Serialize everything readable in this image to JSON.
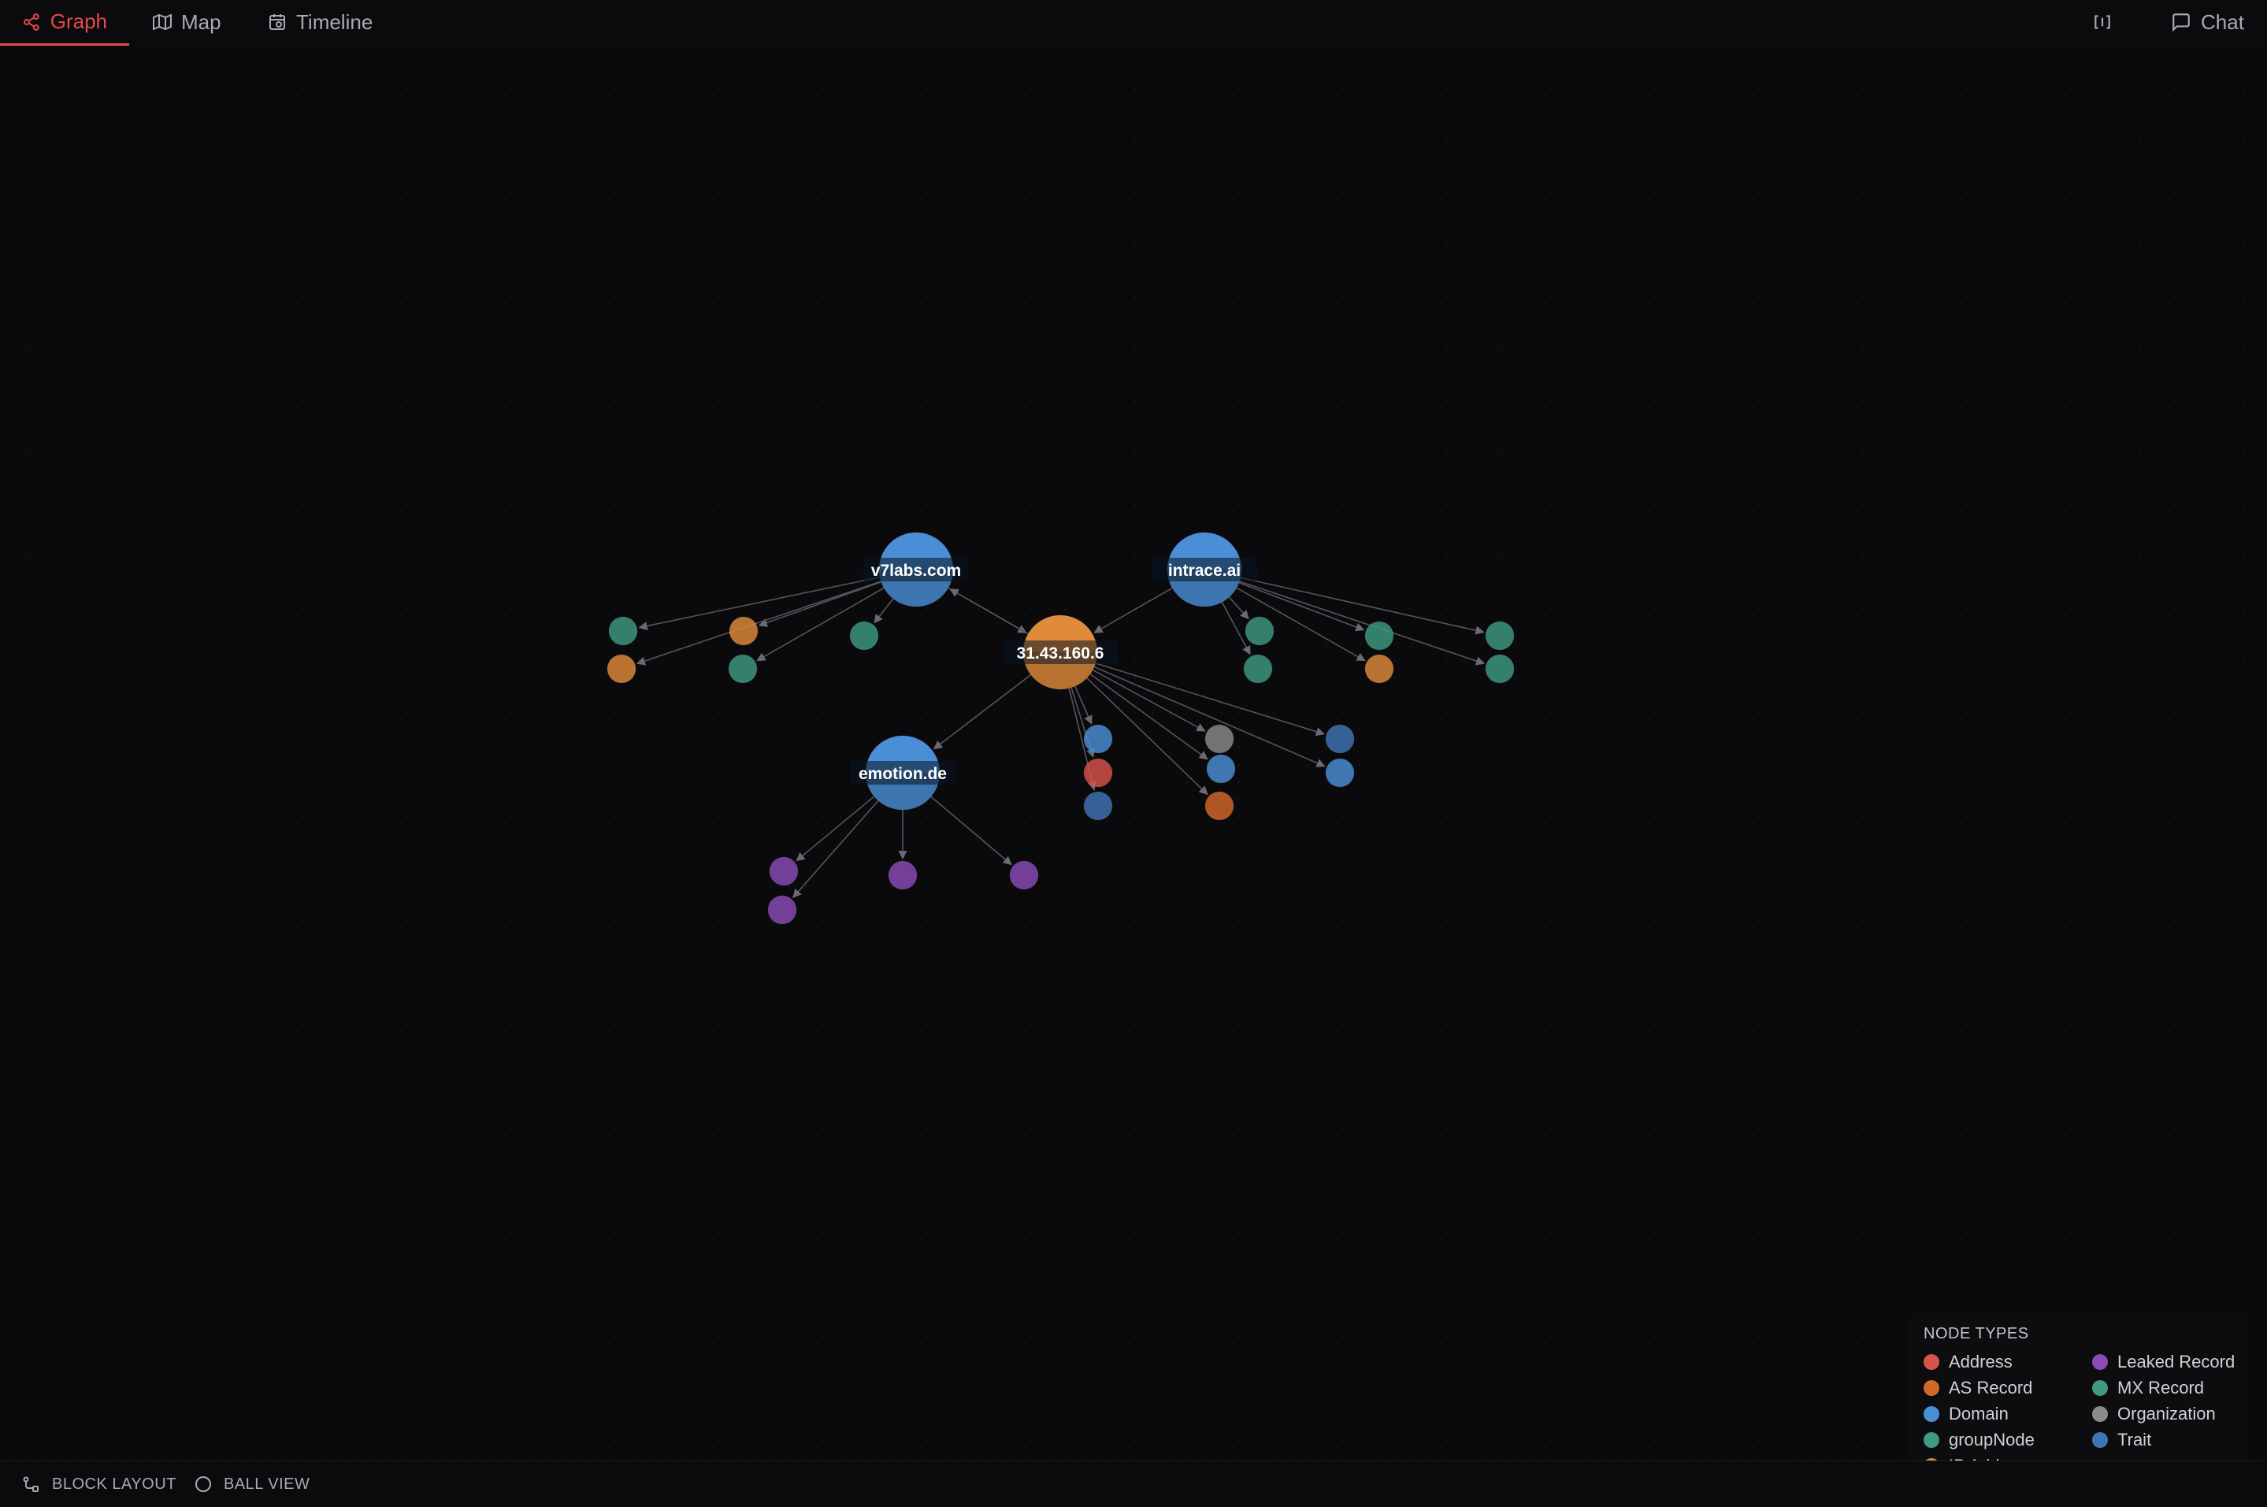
{
  "tabs": [
    {
      "label": "Graph",
      "icon": "share-nodes-icon",
      "active": true
    },
    {
      "label": "Map",
      "icon": "map-icon",
      "active": false
    },
    {
      "label": "Timeline",
      "icon": "calendar-clock-icon",
      "active": false
    }
  ],
  "right_controls": {
    "panel_toggle_icon": "split-panel-icon",
    "chat_label": "Chat",
    "chat_icon": "chat-bubble-icon"
  },
  "colors": {
    "accent": "#e5484d",
    "Address": "#d9534a",
    "AS Record": "#d2692b",
    "Domain": "#4a8fd6",
    "groupNode": "#3f9a80",
    "IP Address": "#e08a3c",
    "Leaked Record": "#8a4bb8",
    "MX Record": "#3f9a80",
    "Organization": "#8a8a8a",
    "Trait": "#3f75b5",
    "edge": "#55555c"
  },
  "graph": {
    "nodes": [
      {
        "id": "v7",
        "label": "v7labs.com",
        "type": "Domain",
        "major": true
      },
      {
        "id": "ip",
        "label": "31.43.160.6",
        "type": "IP Address",
        "major": true
      },
      {
        "id": "intrace",
        "label": "intrace.ai",
        "type": "Domain",
        "major": true
      },
      {
        "id": "emotion",
        "label": "emotion.de",
        "type": "Domain",
        "major": true
      },
      {
        "id": "v1",
        "label": "",
        "type": "MX Record"
      },
      {
        "id": "v2",
        "label": "",
        "type": "IP Address"
      },
      {
        "id": "v3",
        "label": "",
        "type": "IP Address"
      },
      {
        "id": "v4",
        "label": "",
        "type": "MX Record"
      },
      {
        "id": "v5",
        "label": "",
        "type": "MX Record"
      },
      {
        "id": "i1",
        "label": "",
        "type": "MX Record"
      },
      {
        "id": "i2",
        "label": "",
        "type": "MX Record"
      },
      {
        "id": "i3",
        "label": "",
        "type": "MX Record"
      },
      {
        "id": "i4",
        "label": "",
        "type": "MX Record"
      },
      {
        "id": "i5",
        "label": "",
        "type": "IP Address"
      },
      {
        "id": "i6",
        "label": "",
        "type": "MX Record"
      },
      {
        "id": "p1",
        "label": "",
        "type": "Domain"
      },
      {
        "id": "p2",
        "label": "",
        "type": "Address"
      },
      {
        "id": "p3",
        "label": "",
        "type": "Trait"
      },
      {
        "id": "p4",
        "label": "",
        "type": "Organization"
      },
      {
        "id": "p5",
        "label": "",
        "type": "Domain"
      },
      {
        "id": "p6",
        "label": "",
        "type": "AS Record"
      },
      {
        "id": "p7",
        "label": "",
        "type": "Trait"
      },
      {
        "id": "p8",
        "label": "",
        "type": "Domain"
      },
      {
        "id": "e1",
        "label": "",
        "type": "Leaked Record"
      },
      {
        "id": "e2",
        "label": "",
        "type": "Leaked Record"
      },
      {
        "id": "e3",
        "label": "",
        "type": "Leaked Record"
      },
      {
        "id": "e4",
        "label": "",
        "type": "Leaked Record"
      }
    ],
    "edges": [
      [
        "v7",
        "v1"
      ],
      [
        "v7",
        "v2"
      ],
      [
        "v7",
        "v3"
      ],
      [
        "v7",
        "v4"
      ],
      [
        "v7",
        "v5"
      ],
      [
        "v7",
        "ip"
      ],
      [
        "ip",
        "v7"
      ],
      [
        "intrace",
        "i1"
      ],
      [
        "intrace",
        "i2"
      ],
      [
        "intrace",
        "i3"
      ],
      [
        "intrace",
        "i4"
      ],
      [
        "intrace",
        "i5"
      ],
      [
        "intrace",
        "i6"
      ],
      [
        "intrace",
        "ip"
      ],
      [
        "ip",
        "p1"
      ],
      [
        "ip",
        "p2"
      ],
      [
        "ip",
        "p3"
      ],
      [
        "ip",
        "p4"
      ],
      [
        "ip",
        "p5"
      ],
      [
        "ip",
        "p6"
      ],
      [
        "ip",
        "p7"
      ],
      [
        "ip",
        "p8"
      ],
      [
        "ip",
        "emotion"
      ],
      [
        "emotion",
        "e1"
      ],
      [
        "emotion",
        "e2"
      ],
      [
        "emotion",
        "e3"
      ],
      [
        "emotion",
        "e4"
      ]
    ]
  },
  "legend": {
    "title": "NODE TYPES",
    "items": [
      {
        "label": "Address",
        "color": "#d9534a"
      },
      {
        "label": "Leaked Record",
        "color": "#8a4bb8"
      },
      {
        "label": "AS Record",
        "color": "#d2692b"
      },
      {
        "label": "MX Record",
        "color": "#3f9a80"
      },
      {
        "label": "Domain",
        "color": "#4a8fd6"
      },
      {
        "label": "Organization",
        "color": "#8a8a8a"
      },
      {
        "label": "groupNode",
        "color": "#3f9a80"
      },
      {
        "label": "Trait",
        "color": "#3f75b5"
      },
      {
        "label": "IP Address",
        "color": "#e08a3c"
      }
    ]
  },
  "bottom_controls": [
    {
      "label": "BLOCK LAYOUT",
      "icon": "block-layout-icon"
    },
    {
      "label": "BALL VIEW",
      "icon": "circle-icon"
    }
  ]
}
